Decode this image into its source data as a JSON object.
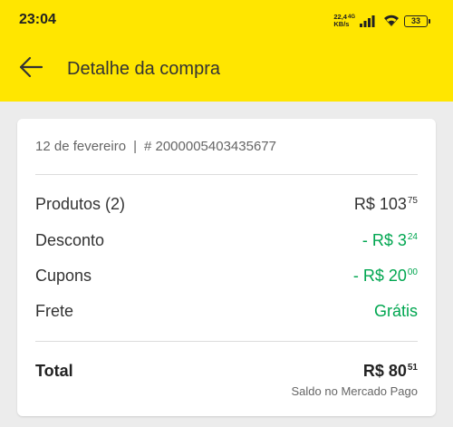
{
  "status_bar": {
    "time": "23:04",
    "net_speed_value": "22,4",
    "net_type": "4G",
    "net_speed_unit": "KB/s",
    "battery": "33"
  },
  "header": {
    "title": "Detalhe da compra",
    "back_icon": "arrow-left-icon"
  },
  "purchase": {
    "date": "12 de fevereiro",
    "separator": "|",
    "order_number": "# 2000005403435677"
  },
  "summary": {
    "products": {
      "label": "Produtos (2)",
      "main": "R$ 103",
      "cents": "75"
    },
    "discount": {
      "label": "Desconto",
      "main": "- R$ 3",
      "cents": "24"
    },
    "coupons": {
      "label": "Cupons",
      "main": "- R$ 20",
      "cents": "00"
    },
    "shipping": {
      "label": "Frete",
      "value": "Grátis"
    },
    "total": {
      "label": "Total",
      "main": "R$ 80",
      "cents": "51"
    },
    "payment_note": "Saldo no Mercado Pago"
  },
  "colors": {
    "brand_yellow": "#ffe600",
    "discount_green": "#00a650",
    "background": "#ececec"
  }
}
